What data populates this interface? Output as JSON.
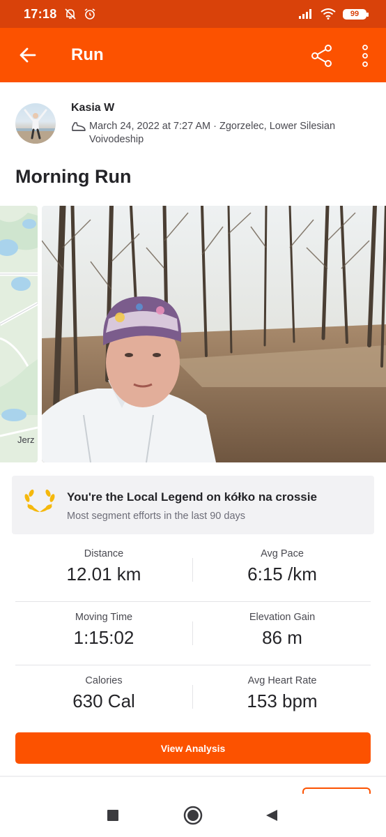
{
  "status_bar": {
    "time": "17:18",
    "battery": "99",
    "icons": [
      "bell-off-icon",
      "alarm-icon",
      "signal-icon",
      "wifi-icon",
      "battery-icon"
    ]
  },
  "app_bar": {
    "title": "Run",
    "icons": [
      "arrow-left-icon",
      "share-icon",
      "more-vertical-icon"
    ]
  },
  "athlete": {
    "name": "Kasia W",
    "meta": "March 24, 2022 at 7:27 AM · Zgorzelec, Lower Silesian Voivodeship"
  },
  "activity": {
    "title": "Morning Run",
    "map_label": "Jerz"
  },
  "local_legend": {
    "title": "You're the Local Legend on kółko na crossie",
    "subtitle": "Most segment efforts in the last 90 days"
  },
  "stats": [
    [
      {
        "label": "Distance",
        "value": "12.01 km"
      },
      {
        "label": "Avg Pace",
        "value": "6:15 /km"
      }
    ],
    [
      {
        "label": "Moving Time",
        "value": "1:15:02"
      },
      {
        "label": "Elevation Gain",
        "value": "86 m"
      }
    ],
    [
      {
        "label": "Calories",
        "value": "630 Cal"
      },
      {
        "label": "Avg Heart Rate",
        "value": "153 bpm"
      }
    ]
  ],
  "view_analysis_label": "View Analysis",
  "colors": {
    "brand": "#fc5200",
    "status_bar": "#d9420a",
    "text": "#242428",
    "laurel": "#f5b80c"
  },
  "nav_bar": [
    "recents-square-icon",
    "home-circle-icon",
    "back-triangle-icon"
  ]
}
